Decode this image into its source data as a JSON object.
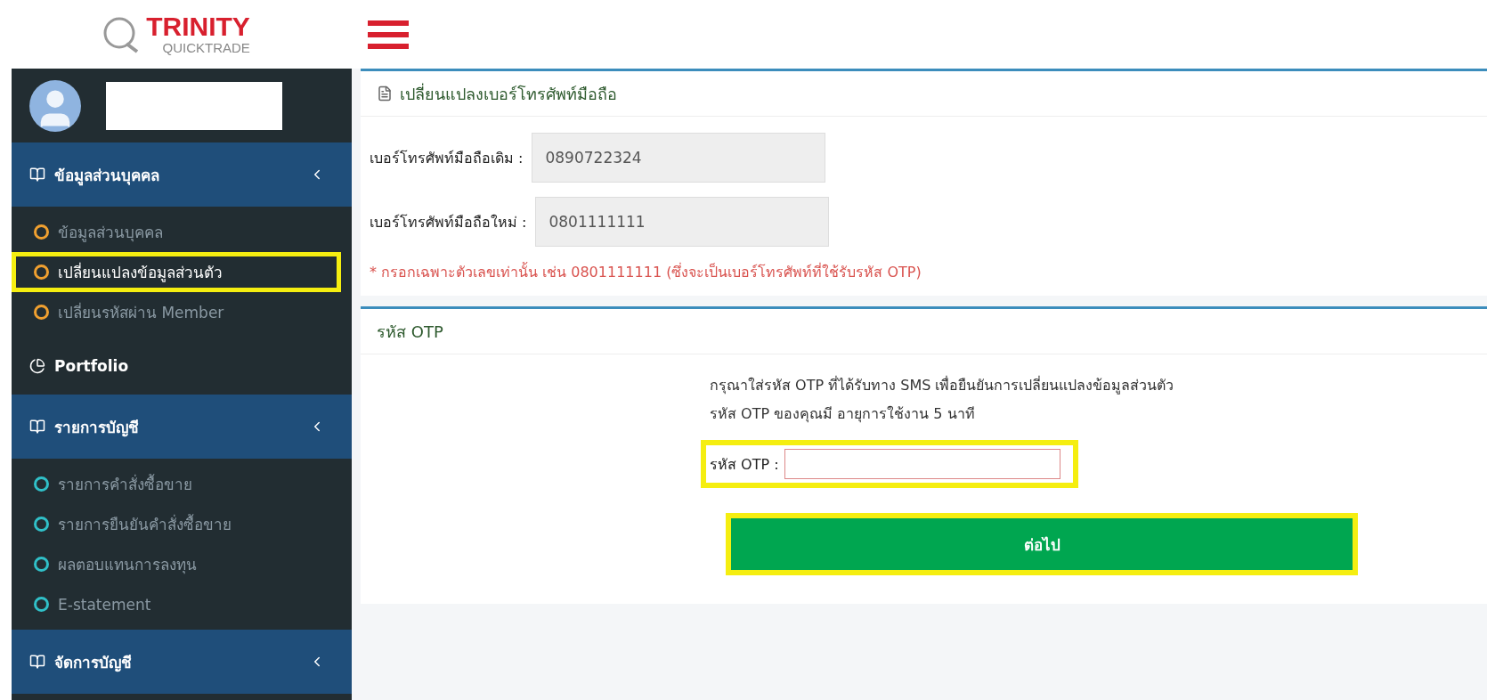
{
  "logo": {
    "title": "TRINITY",
    "subtitle": "QUICKTRADE"
  },
  "sidebar": {
    "items": [
      {
        "kind": "group",
        "label": "ข้อมูลส่วนบุคคล",
        "expanded": true,
        "children": [
          {
            "label": "ข้อมูลส่วนบุคคล",
            "selected": false,
            "highlighted": false,
            "color": "#f0a030"
          },
          {
            "label": "เปลี่ยนแปลงข้อมูลส่วนตัว",
            "selected": true,
            "highlighted": true,
            "color": "#f0a030"
          },
          {
            "label": "เปลี่ยนรหัสผ่าน Member",
            "selected": false,
            "highlighted": false,
            "color": "#f0a030"
          }
        ]
      },
      {
        "kind": "link",
        "label": "Portfolio"
      },
      {
        "kind": "group",
        "label": "รายการบัญชี",
        "expanded": true,
        "children": [
          {
            "label": "รายการคำสั่งซื้อขาย",
            "selected": false,
            "highlighted": false,
            "color": "#30c0c8"
          },
          {
            "label": "รายการยืนยันคำสั่งซื้อขาย",
            "selected": false,
            "highlighted": false,
            "color": "#30c0c8"
          },
          {
            "label": "ผลตอบแทนการลงทุน",
            "selected": false,
            "highlighted": false,
            "color": "#30c0c8"
          },
          {
            "label": "E-statement",
            "selected": false,
            "highlighted": false,
            "color": "#30c0c8"
          }
        ]
      },
      {
        "kind": "group",
        "label": "จัดการบัญชี",
        "expanded": false
      }
    ]
  },
  "phone_panel": {
    "title": "เปลี่ยนแปลงเบอร์โทรศัพท์มือถือ",
    "fields": [
      {
        "label": "เบอร์โทรศัพท์มือถือเดิม :",
        "value": "0890722324"
      },
      {
        "label": "เบอร์โทรศัพท์มือถือใหม่ :",
        "value": "0801111111"
      }
    ],
    "note": "* กรอกเฉพาะตัวเลขเท่านั้น เช่น 0801111111 (ซึ่งจะเป็นเบอร์โทรศัพท์ที่ใช้รับรหัส OTP)"
  },
  "otp_panel": {
    "title": "รหัส OTP",
    "instructions": [
      "กรุณาใส่รหัส OTP ที่ได้รับทาง SMS เพื่อยืนยันการเปลี่ยนแปลงข้อมูลส่วนตัว",
      "รหัส OTP ของคุณมี อายุการใช้งาน 5 นาที"
    ],
    "field": {
      "label": "รหัส OTP :",
      "highlighted": true
    },
    "button": {
      "label": "ต่อไป",
      "highlighted": true
    }
  }
}
